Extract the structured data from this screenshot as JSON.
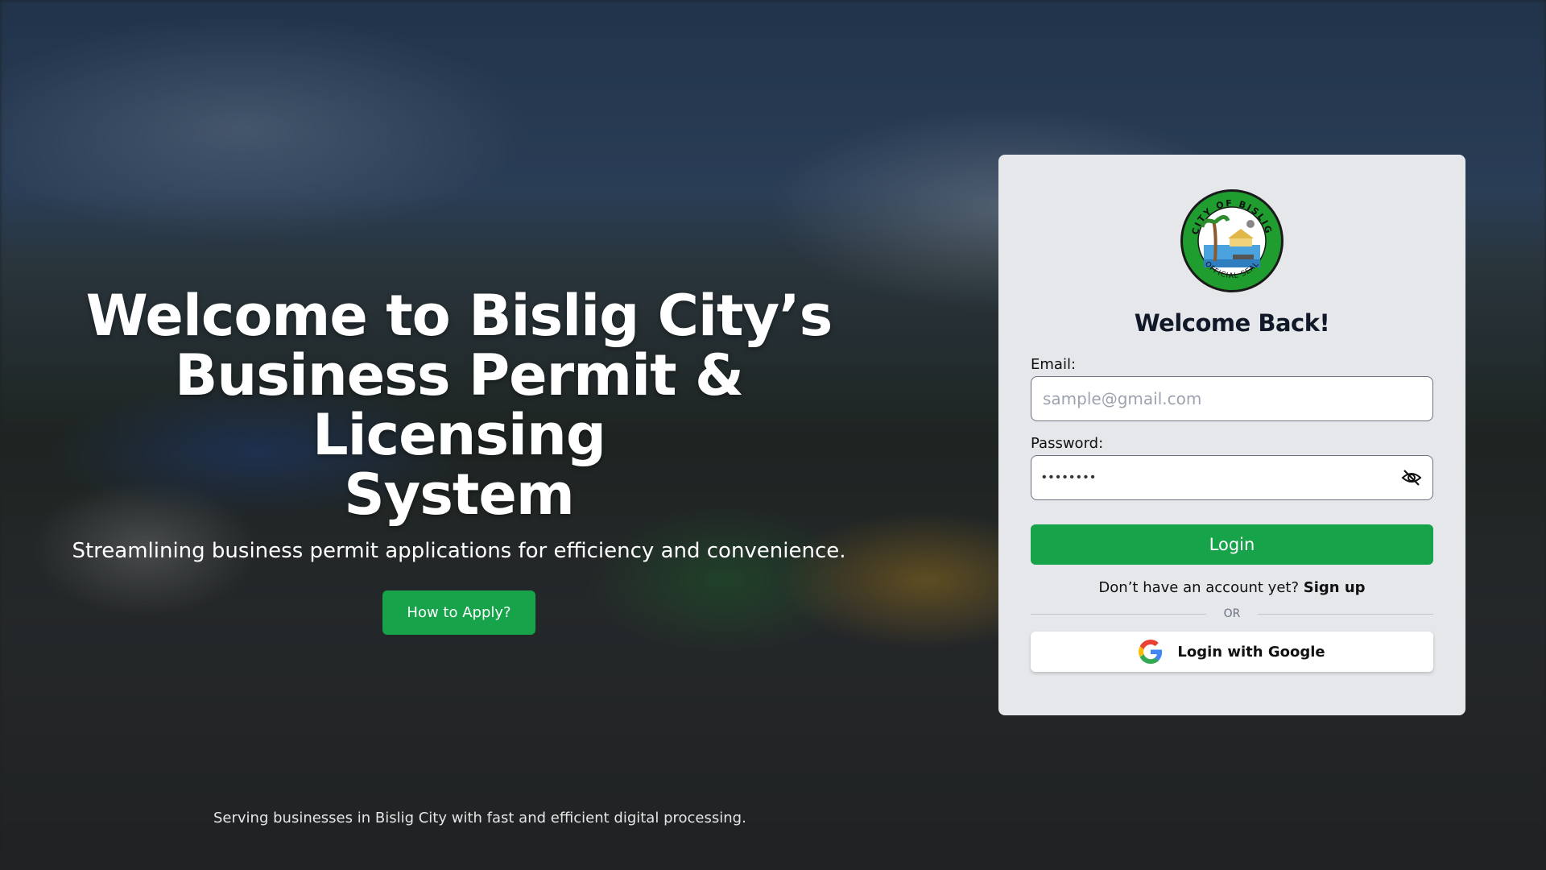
{
  "hero": {
    "title_line1": "Welcome to Bislig City’s",
    "title_line2": "Business Permit & Licensing",
    "title_line3": "System",
    "subtitle": "Streamlining business permit applications for efficiency and convenience.",
    "apply_button": "How to Apply?"
  },
  "footer": {
    "note": "Serving businesses in Bislig City with fast and efficient digital processing."
  },
  "login": {
    "seal_top_text": "CITY OF BISLIG",
    "seal_bottom_text": "OFFICIAL SEAL",
    "heading": "Welcome Back!",
    "email_label": "Email:",
    "email_placeholder": "sample@gmail.com",
    "password_label": "Password:",
    "password_masked": "••••••••",
    "password_toggle_icon": "eye-slash-icon",
    "login_button": "Login",
    "signup_prompt": "Don’t have an account yet?",
    "signup_link": "Sign up",
    "divider": "OR",
    "google_button": "Login with Google",
    "google_icon": "google-icon"
  },
  "colors": {
    "primary_green": "#16a34a",
    "card_bg": "#e5e7eb"
  }
}
